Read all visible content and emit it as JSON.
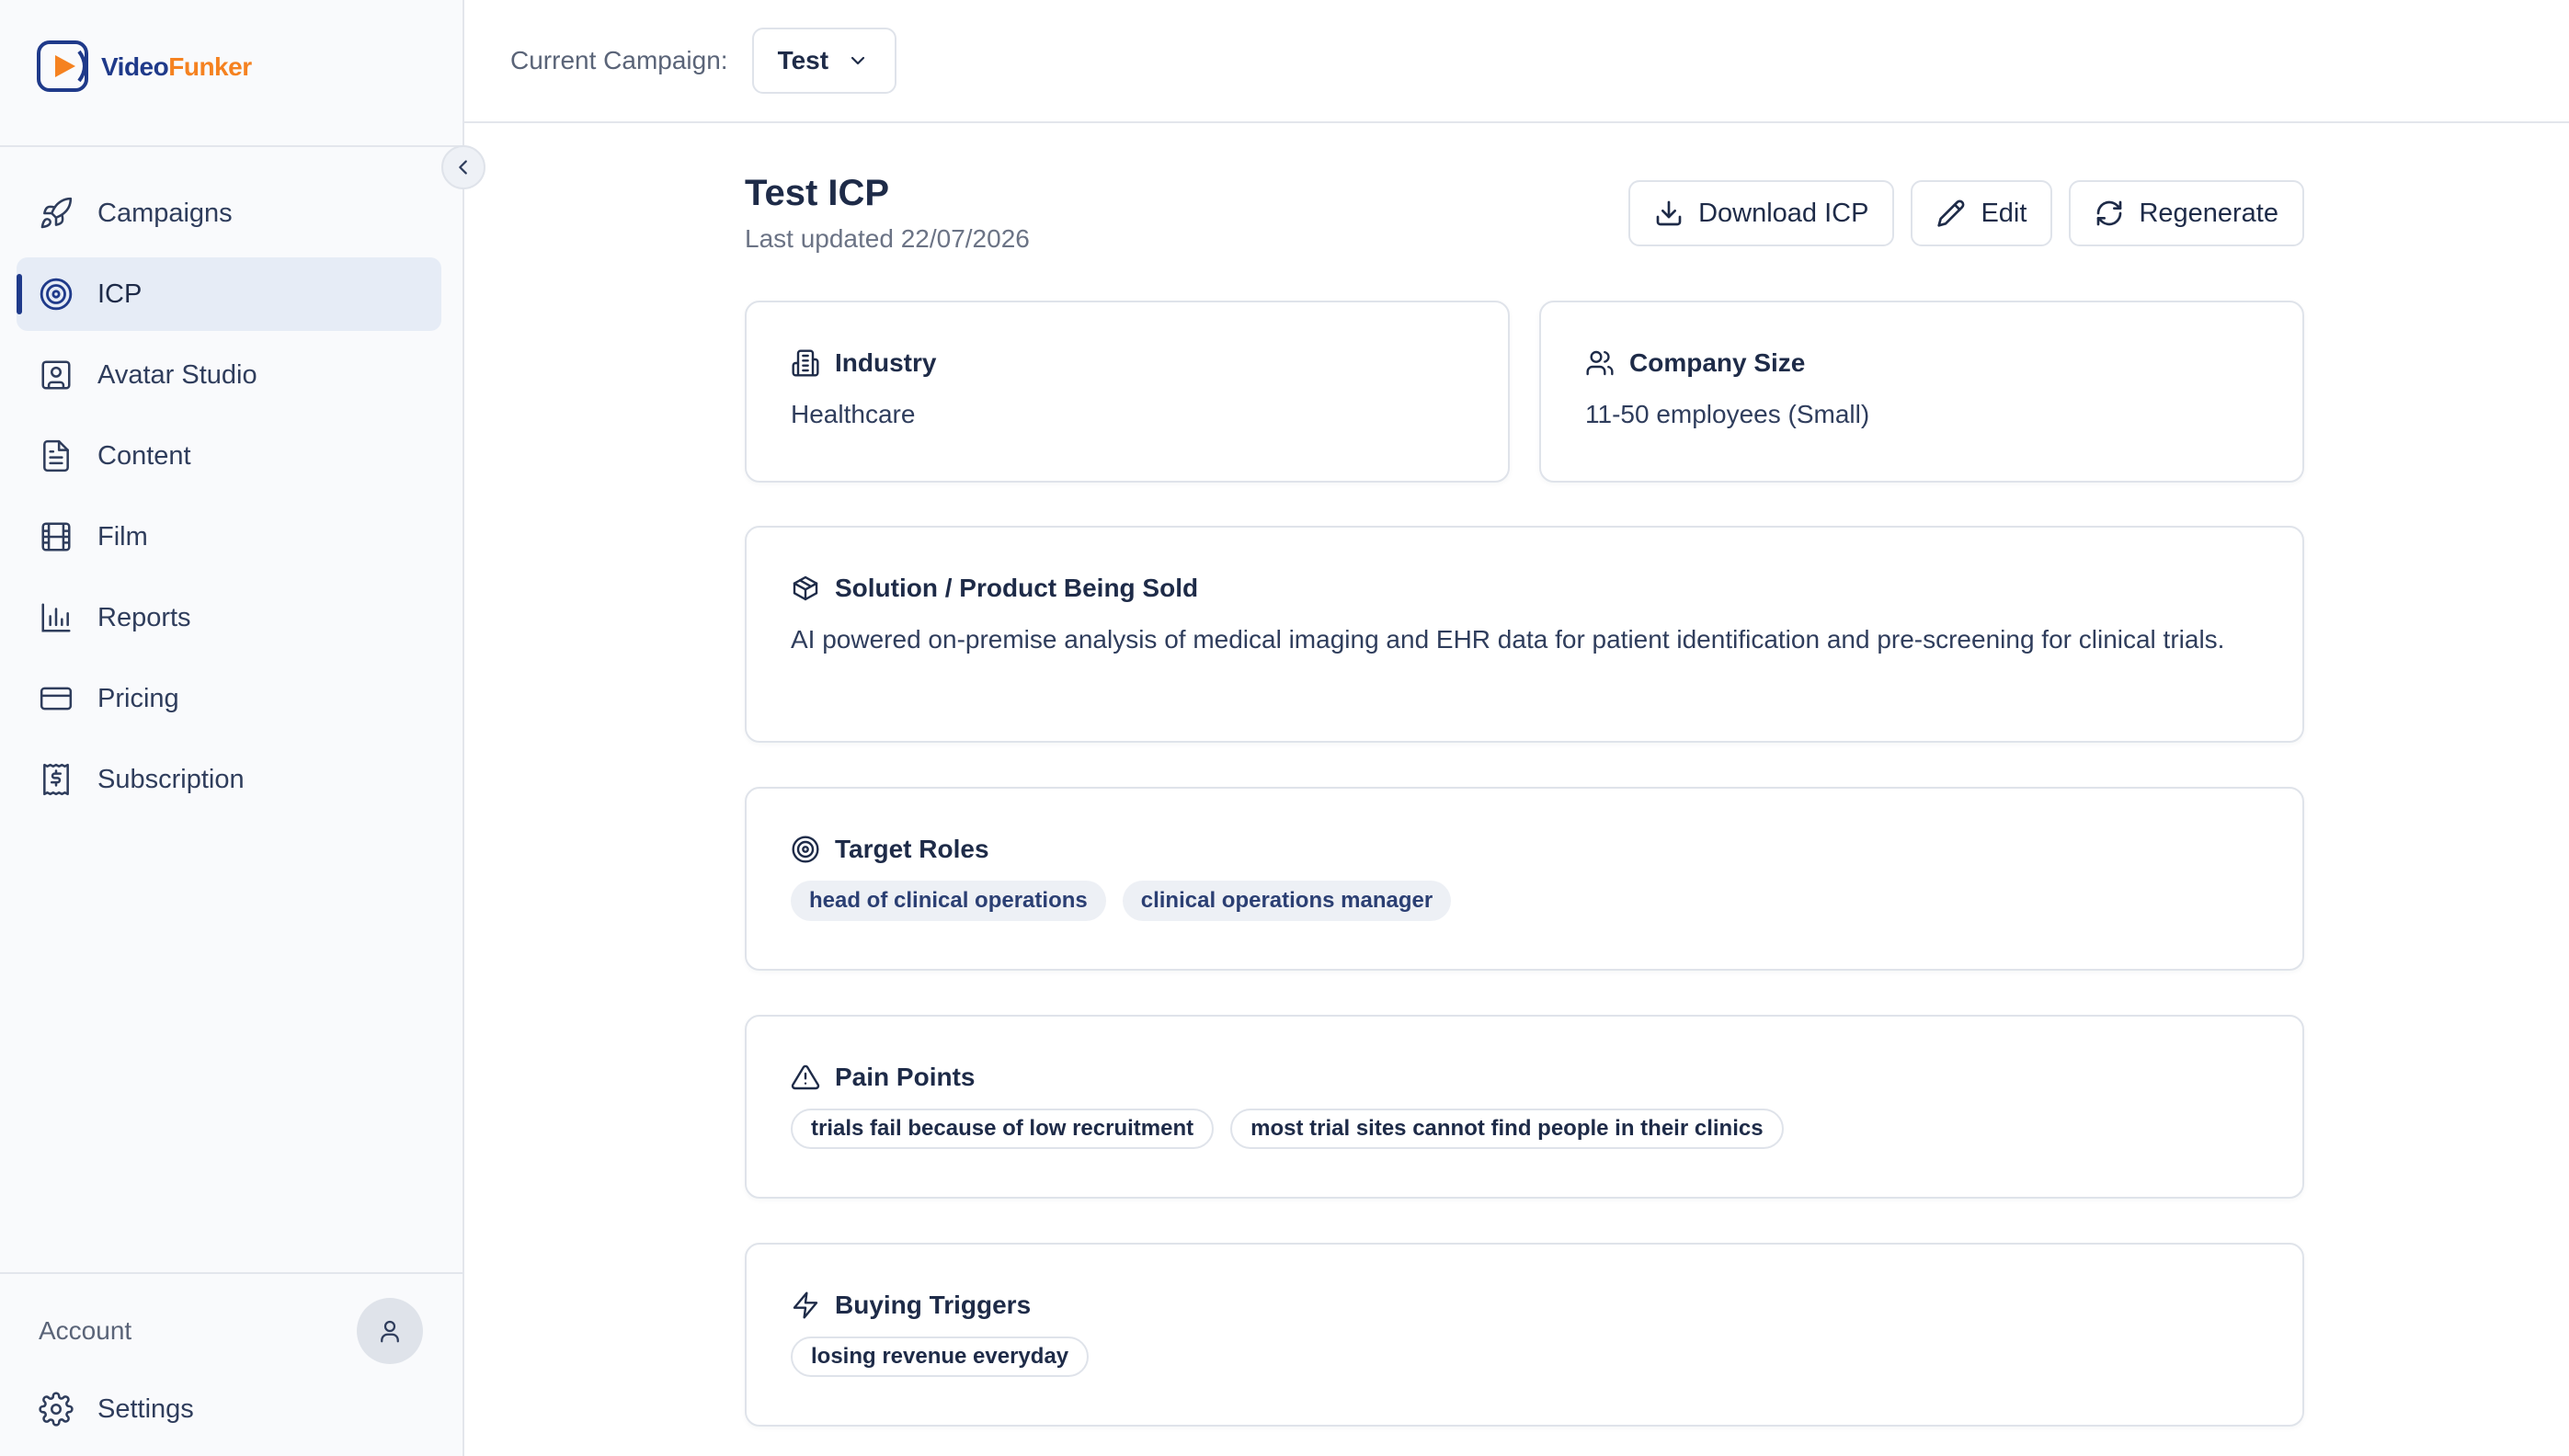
{
  "app": {
    "brand_part1": "Video",
    "brand_part2": "Funker",
    "brand_colors": {
      "primary": "#1f3a8a",
      "accent": "#f58220"
    }
  },
  "sidebar": {
    "items": [
      {
        "label": "Campaigns",
        "icon": "rocket-icon"
      },
      {
        "label": "ICP",
        "icon": "target-icon",
        "active": true
      },
      {
        "label": "Avatar Studio",
        "icon": "avatar-frame-icon"
      },
      {
        "label": "Content",
        "icon": "document-icon"
      },
      {
        "label": "Film",
        "icon": "film-icon"
      },
      {
        "label": "Reports",
        "icon": "bar-chart-icon"
      },
      {
        "label": "Pricing",
        "icon": "credit-card-icon"
      },
      {
        "label": "Subscription",
        "icon": "receipt-dollar-icon"
      }
    ],
    "account_label": "Account",
    "settings_label": "Settings"
  },
  "topbar": {
    "label": "Current Campaign:",
    "selected_campaign": "Test"
  },
  "main": {
    "title": "Test ICP",
    "subtitle": "Last updated 22/07/2026",
    "actions": {
      "download": "Download ICP",
      "edit": "Edit",
      "regenerate": "Regenerate"
    },
    "industry": {
      "heading": "Industry",
      "value": "Healthcare"
    },
    "company_size": {
      "heading": "Company Size",
      "value": "11-50 employees (Small)"
    },
    "solution": {
      "heading": "Solution / Product Being Sold",
      "value": "AI powered on-premise analysis of medical imaging and EHR data for patient identification and pre-screening for clinical trials."
    },
    "target_roles": {
      "heading": "Target Roles",
      "tags": [
        "head of clinical operations",
        "clinical operations manager"
      ]
    },
    "pain_points": {
      "heading": "Pain Points",
      "tags": [
        "trials fail because of low recruitment",
        "most trial sites cannot find people in their clinics"
      ]
    },
    "buying_triggers": {
      "heading": "Buying Triggers",
      "tags": [
        "losing revenue everyday"
      ]
    }
  }
}
